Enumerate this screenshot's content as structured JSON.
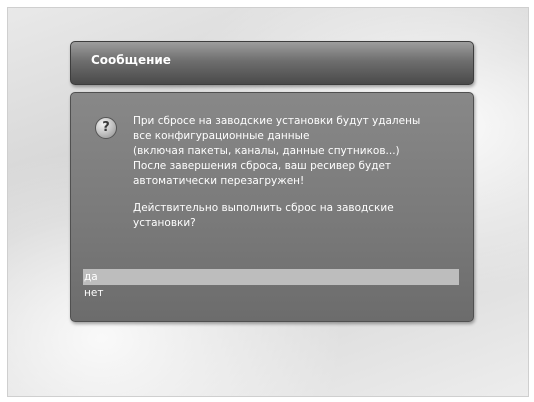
{
  "dialog": {
    "title": "Сообщение",
    "icon": "question-icon",
    "icon_glyph": "?",
    "message_lines": [
      "При сбросе на заводские установки будут удалены",
      "все конфигурационные данные",
      "(включая пакеты, каналы, данные спутников...)",
      "После завершения сброса, ваш ресивер будет",
      "автоматически перезагружен!"
    ],
    "question_lines": [
      "Действительно выполнить сброс на заводские",
      "установки?"
    ],
    "options": [
      {
        "label": "да",
        "selected": true
      },
      {
        "label": "нет",
        "selected": false
      }
    ]
  }
}
